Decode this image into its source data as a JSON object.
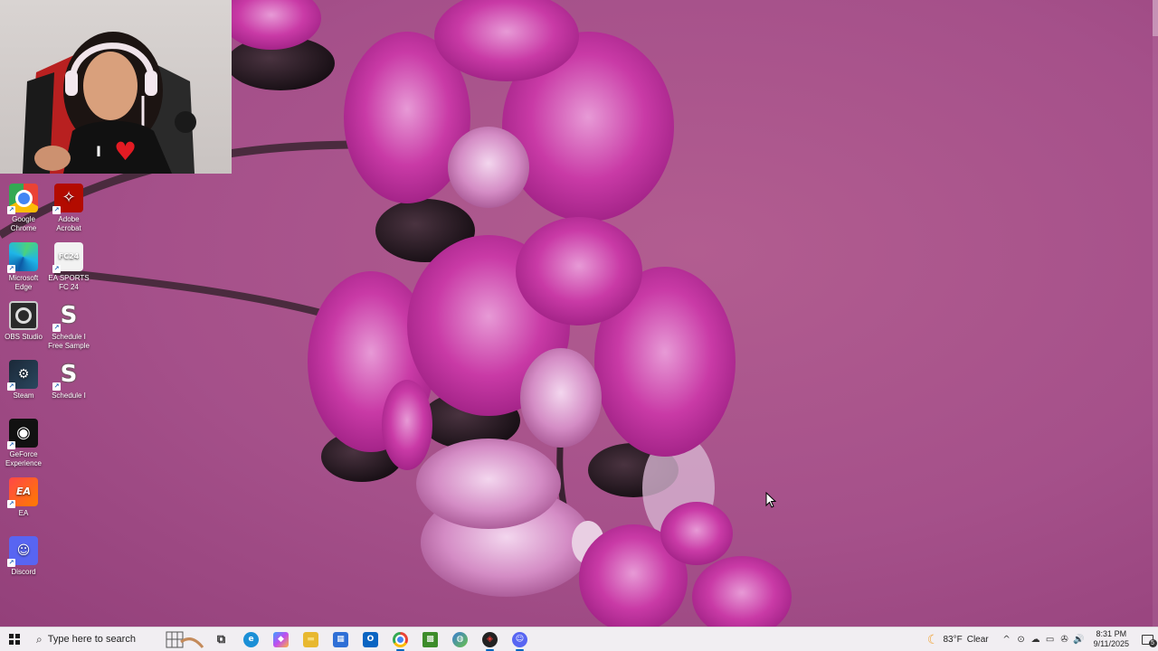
{
  "desktop": {
    "icons": [
      {
        "label": "Google Chrome",
        "icon": "chrome-icon"
      },
      {
        "label": "Adobe Acrobat",
        "icon": "acrobat-icon",
        "glyph": "✧"
      },
      {
        "label": "Microsoft Edge",
        "icon": "edge-icon"
      },
      {
        "label": "EA SPORTS FC 24",
        "icon": "fc24-icon",
        "glyph": "FC24"
      },
      {
        "label": "OBS Studio",
        "icon": "obs-icon"
      },
      {
        "label": "Schedule I Free Sample",
        "icon": "schedule-icon",
        "glyph": "S"
      },
      {
        "label": "Steam",
        "icon": "steam-icon",
        "glyph": "⚙"
      },
      {
        "label": "Schedule I",
        "icon": "schedule-icon",
        "glyph": "S"
      },
      {
        "label": "GeForce Experience",
        "icon": "nvidia-icon",
        "glyph": "◉"
      },
      {
        "label": "EA",
        "icon": "ea-icon",
        "glyph": "EA"
      },
      {
        "label": "Discord",
        "icon": "discord-icon",
        "glyph": "☺"
      }
    ],
    "shortcut_glyph": "↗"
  },
  "webcam": {
    "shirt_text": "I",
    "shirt_heart": "♥"
  },
  "taskbar": {
    "search_placeholder": "Type here to search",
    "search_icon": "⌕",
    "apps": [
      {
        "name": "task-view",
        "glyph": "⧉",
        "color": "#333333"
      },
      {
        "name": "edge",
        "glyph": "e",
        "color": "#1b8fd6"
      },
      {
        "name": "copilot",
        "glyph": "◆",
        "color": "#7a4df0"
      },
      {
        "name": "file-explorer",
        "glyph": "▬",
        "color": "#e8b830"
      },
      {
        "name": "microsoft-store",
        "glyph": "▦",
        "color": "#2f6fd6"
      },
      {
        "name": "outlook",
        "glyph": "O",
        "color": "#0a64c2"
      },
      {
        "name": "chrome",
        "glyph": "◎",
        "color": "#dd4b39",
        "active": true
      },
      {
        "name": "minecraft",
        "glyph": "▩",
        "color": "#3d8c2a"
      },
      {
        "name": "paint",
        "glyph": "◍",
        "color": "#3a7bd5"
      },
      {
        "name": "roblox-studio",
        "glyph": "◈",
        "color": "#d22f2f",
        "active": true
      },
      {
        "name": "discord",
        "glyph": "☺",
        "color": "#5865f2",
        "active": true
      }
    ],
    "tray": {
      "weather_icon": "☾",
      "temperature": "83°F",
      "condition": "Clear",
      "chevron": "^",
      "icons": [
        "⊙",
        "☁",
        "▭",
        "✇",
        "🔊"
      ],
      "time": "8:31 PM",
      "date": "9/11/2025",
      "notification_count": "5"
    }
  }
}
